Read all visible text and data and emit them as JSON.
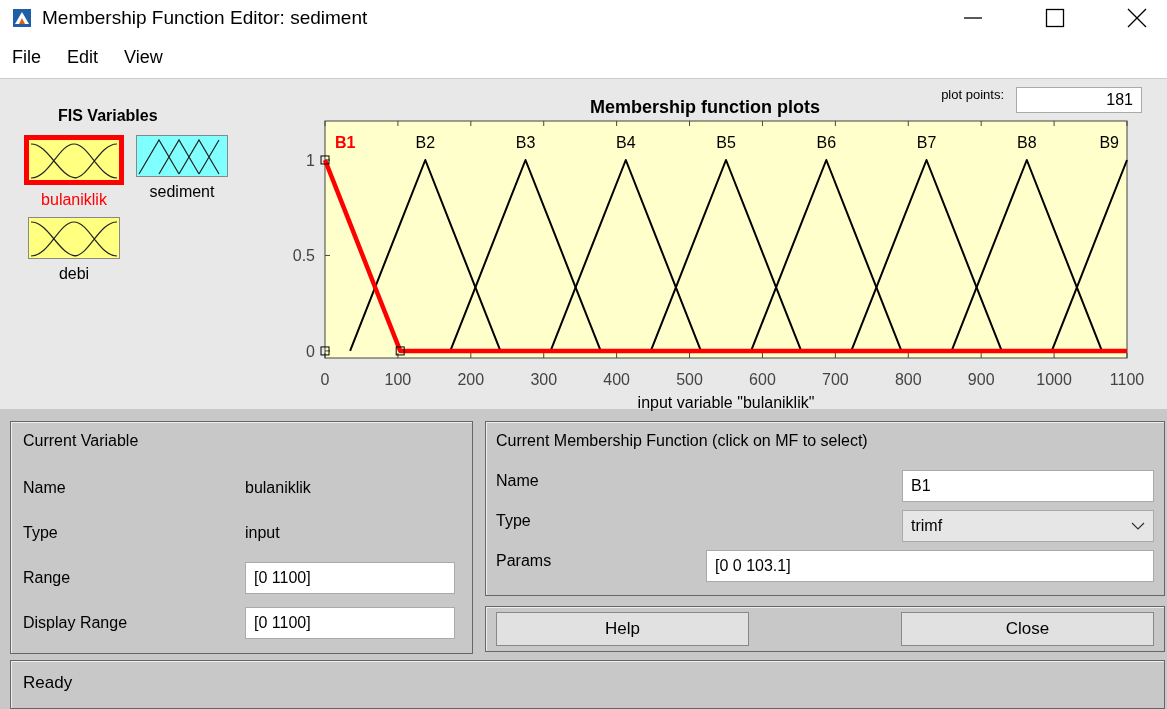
{
  "window": {
    "title": "Membership Function Editor: sediment"
  },
  "menu": [
    "File",
    "Edit",
    "View"
  ],
  "fis_variables": {
    "title": "FIS Variables",
    "items": [
      {
        "label": "bulaniklik",
        "selected": true,
        "kind": "input"
      },
      {
        "label": "sediment",
        "selected": false,
        "kind": "output"
      },
      {
        "label": "debi",
        "selected": false,
        "kind": "input"
      }
    ]
  },
  "plot": {
    "plot_points_label": "plot points:",
    "plot_points": "181",
    "chart_data": {
      "type": "line",
      "title": "Membership function plots",
      "xlabel": "input variable \"bulaniklik\"",
      "x": [
        0,
        34.375,
        68.75,
        103.125,
        137.5,
        171.875,
        206.25,
        240.625,
        275,
        309.375,
        343.75,
        378.125,
        412.5,
        446.875,
        481.25,
        515.625,
        550,
        584.375,
        618.75,
        653.125,
        687.5,
        721.875,
        756.25,
        790.625,
        825,
        859.375,
        893.75,
        928.125,
        962.5,
        996.875,
        1031.25,
        1065.625,
        1100
      ],
      "series": [
        {
          "name": "B1",
          "color": "#ff0000",
          "values": [
            1,
            0.667,
            0.333,
            0,
            0,
            0,
            0,
            0,
            0,
            0,
            0,
            0,
            0,
            0,
            0,
            0,
            0,
            0,
            0,
            0,
            0,
            0,
            0,
            0,
            0,
            0,
            0,
            0,
            0,
            0,
            0,
            0,
            0
          ]
        },
        {
          "name": "B2",
          "color": "#000000",
          "values": [
            null,
            0,
            0.333,
            0.667,
            1,
            0.667,
            0.333,
            0,
            null,
            null,
            null,
            null,
            null,
            null,
            null,
            null,
            null,
            null,
            null,
            null,
            null,
            null,
            null,
            null,
            null,
            null,
            null,
            null,
            null,
            null,
            null,
            null,
            null
          ]
        },
        {
          "name": "B3",
          "color": "#000000",
          "values": [
            null,
            null,
            null,
            null,
            null,
            0,
            0.333,
            0.667,
            1,
            0.667,
            0.333,
            0,
            null,
            null,
            null,
            null,
            null,
            null,
            null,
            null,
            null,
            null,
            null,
            null,
            null,
            null,
            null,
            null,
            null,
            null,
            null,
            null,
            null
          ]
        },
        {
          "name": "B4",
          "color": "#000000",
          "values": [
            null,
            null,
            null,
            null,
            null,
            null,
            null,
            null,
            null,
            0,
            0.333,
            0.667,
            1,
            0.667,
            0.333,
            0,
            null,
            null,
            null,
            null,
            null,
            null,
            null,
            null,
            null,
            null,
            null,
            null,
            null,
            null,
            null,
            null,
            null
          ]
        },
        {
          "name": "B5",
          "color": "#000000",
          "values": [
            null,
            null,
            null,
            null,
            null,
            null,
            null,
            null,
            null,
            null,
            null,
            null,
            null,
            0,
            0.333,
            0.667,
            1,
            0.667,
            0.333,
            0,
            null,
            null,
            null,
            null,
            null,
            null,
            null,
            null,
            null,
            null,
            null,
            null,
            null
          ]
        },
        {
          "name": "B6",
          "color": "#000000",
          "values": [
            null,
            null,
            null,
            null,
            null,
            null,
            null,
            null,
            null,
            null,
            null,
            null,
            null,
            null,
            null,
            null,
            null,
            0,
            0.333,
            0.667,
            1,
            0.667,
            0.333,
            0,
            null,
            null,
            null,
            null,
            null,
            null,
            null,
            null,
            null
          ]
        },
        {
          "name": "B7",
          "color": "#000000",
          "values": [
            null,
            null,
            null,
            null,
            null,
            null,
            null,
            null,
            null,
            null,
            null,
            null,
            null,
            null,
            null,
            null,
            null,
            null,
            null,
            null,
            null,
            0,
            0.333,
            0.667,
            1,
            0.667,
            0.333,
            0,
            null,
            null,
            null,
            null,
            null
          ]
        },
        {
          "name": "B8",
          "color": "#000000",
          "values": [
            null,
            null,
            null,
            null,
            null,
            null,
            null,
            null,
            null,
            null,
            null,
            null,
            null,
            null,
            null,
            null,
            null,
            null,
            null,
            null,
            null,
            null,
            null,
            null,
            null,
            0,
            0.333,
            0.667,
            1,
            0.667,
            0.333,
            0,
            null
          ]
        },
        {
          "name": "B9",
          "color": "#000000",
          "values": [
            null,
            null,
            null,
            null,
            null,
            null,
            null,
            null,
            null,
            null,
            null,
            null,
            null,
            null,
            null,
            null,
            null,
            null,
            null,
            null,
            null,
            null,
            null,
            null,
            null,
            null,
            null,
            null,
            null,
            0,
            0.333,
            0.667,
            1
          ]
        }
      ],
      "xlim": [
        0,
        1100
      ],
      "ylim": [
        -0.037,
        1.204
      ],
      "xticks": [
        0,
        100,
        200,
        300,
        400,
        500,
        600,
        700,
        800,
        900,
        1000,
        1100
      ],
      "yticks": [
        0,
        0.5,
        1
      ]
    }
  },
  "current_variable": {
    "title": "Current Variable",
    "fields": [
      {
        "label": "Name",
        "value": "bulaniklik",
        "kind": "text"
      },
      {
        "label": "Type",
        "value": "input",
        "kind": "text"
      },
      {
        "label": "Range",
        "value": "[0 1100]",
        "kind": "input"
      },
      {
        "label": "Display Range",
        "value": "[0 1100]",
        "kind": "input"
      }
    ]
  },
  "current_mf": {
    "title": "Current Membership Function (click on MF to select)",
    "fields": [
      {
        "label": "Name",
        "value": "B1",
        "kind": "input"
      },
      {
        "label": "Type",
        "value": "trimf",
        "kind": "select"
      },
      {
        "label": "Params",
        "value": "[0 0 103.1]",
        "kind": "wide"
      }
    ]
  },
  "buttons": [
    "Help",
    "Close"
  ],
  "status": "Ready"
}
